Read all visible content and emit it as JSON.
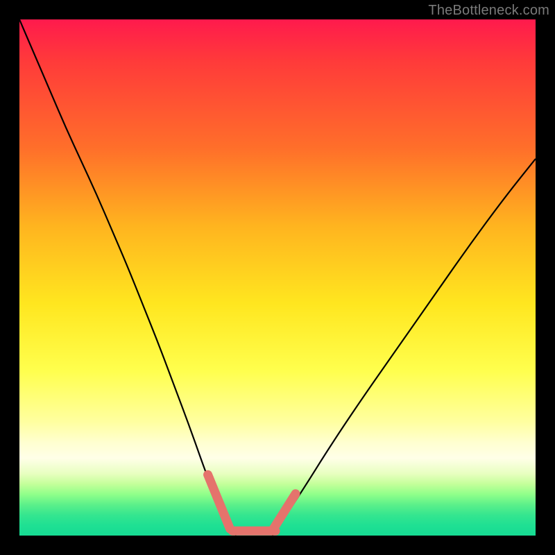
{
  "watermark": {
    "text": "TheBottleneck.com"
  },
  "chart_data": {
    "type": "line",
    "title": "",
    "xlabel": "",
    "ylabel": "",
    "xlim": [
      0,
      100
    ],
    "ylim": [
      0,
      100
    ],
    "grid": false,
    "legend": false,
    "series": [
      {
        "name": "curve-left",
        "x": [
          0,
          3,
          6,
          9,
          12,
          15,
          18,
          21,
          24,
          27,
          30,
          33,
          36,
          38.5,
          40.5,
          42
        ],
        "y": [
          100,
          93,
          86,
          79,
          72.5,
          66,
          59,
          52,
          44.5,
          37,
          29,
          21,
          12.5,
          6,
          2,
          0
        ],
        "stroke": "#000000",
        "width": 2.2
      },
      {
        "name": "curve-right",
        "x": [
          49,
          51,
          55,
          60,
          66,
          73,
          80,
          87,
          94,
          100
        ],
        "y": [
          0,
          3,
          9,
          17,
          26,
          36,
          46,
          56,
          65.5,
          73
        ],
        "stroke": "#000000",
        "width": 2.2
      },
      {
        "name": "marker-segment-left",
        "x": [
          36.5,
          40.8
        ],
        "y": [
          11.8,
          1.3
        ],
        "stroke": "#e5736c",
        "width": 13,
        "cap": "round"
      },
      {
        "name": "marker-segment-bottom",
        "x": [
          41.3,
          49.6
        ],
        "y": [
          0.9,
          0.9
        ],
        "stroke": "#e5736c",
        "width": 13,
        "cap": "round"
      },
      {
        "name": "marker-segment-right",
        "x": [
          49.2,
          53.5
        ],
        "y": [
          1.3,
          8.1
        ],
        "stroke": "#e5736c",
        "width": 13,
        "cap": "round"
      }
    ],
    "background_gradient": {
      "direction": "vertical",
      "stops": [
        {
          "pos": 0,
          "color": "#ff1a4d"
        },
        {
          "pos": 25,
          "color": "#ff6f2a"
        },
        {
          "pos": 55,
          "color": "#ffe61f"
        },
        {
          "pos": 82,
          "color": "#ffffd0"
        },
        {
          "pos": 92,
          "color": "#90ff8a"
        },
        {
          "pos": 100,
          "color": "#16db93"
        }
      ]
    }
  }
}
